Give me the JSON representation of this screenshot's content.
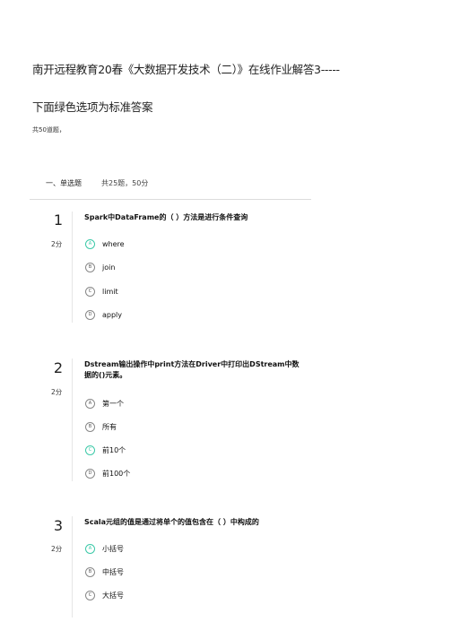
{
  "doc": {
    "title": "南开远程教育20春《大数据开发技术（二）》在线作业解答3-----",
    "subtitle": "下面绿色选项为标准答案",
    "count": "共50道题，"
  },
  "section": {
    "label": "一、单选题",
    "meta": "共25题，50分"
  },
  "colors": {
    "correct": "#3cc9a8",
    "divider": "#dcdcdc"
  },
  "questions": [
    {
      "number": "1",
      "score": "2分",
      "text": "Spark中DataFrame的（ ）方法是进行条件查询",
      "options": [
        {
          "letter": "A",
          "label": "where",
          "correct": true
        },
        {
          "letter": "B",
          "label": "join",
          "correct": false
        },
        {
          "letter": "C",
          "label": "limit",
          "correct": false
        },
        {
          "letter": "D",
          "label": "apply",
          "correct": false
        }
      ]
    },
    {
      "number": "2",
      "score": "2分",
      "text": "Dstream输出操作中print方法在Driver中打印出DStream中数据的()元素。",
      "options": [
        {
          "letter": "A",
          "label": "第一个",
          "correct": false
        },
        {
          "letter": "B",
          "label": "所有",
          "correct": false
        },
        {
          "letter": "C",
          "label": "前10个",
          "correct": true
        },
        {
          "letter": "D",
          "label": "前100个",
          "correct": false
        }
      ]
    },
    {
      "number": "3",
      "score": "2分",
      "text": "Scala元组的值是通过将单个的值包含在（ ）中构成的",
      "options": [
        {
          "letter": "A",
          "label": "小括号",
          "correct": true
        },
        {
          "letter": "B",
          "label": "中括号",
          "correct": false
        },
        {
          "letter": "C",
          "label": "大括号",
          "correct": false
        }
      ]
    }
  ]
}
